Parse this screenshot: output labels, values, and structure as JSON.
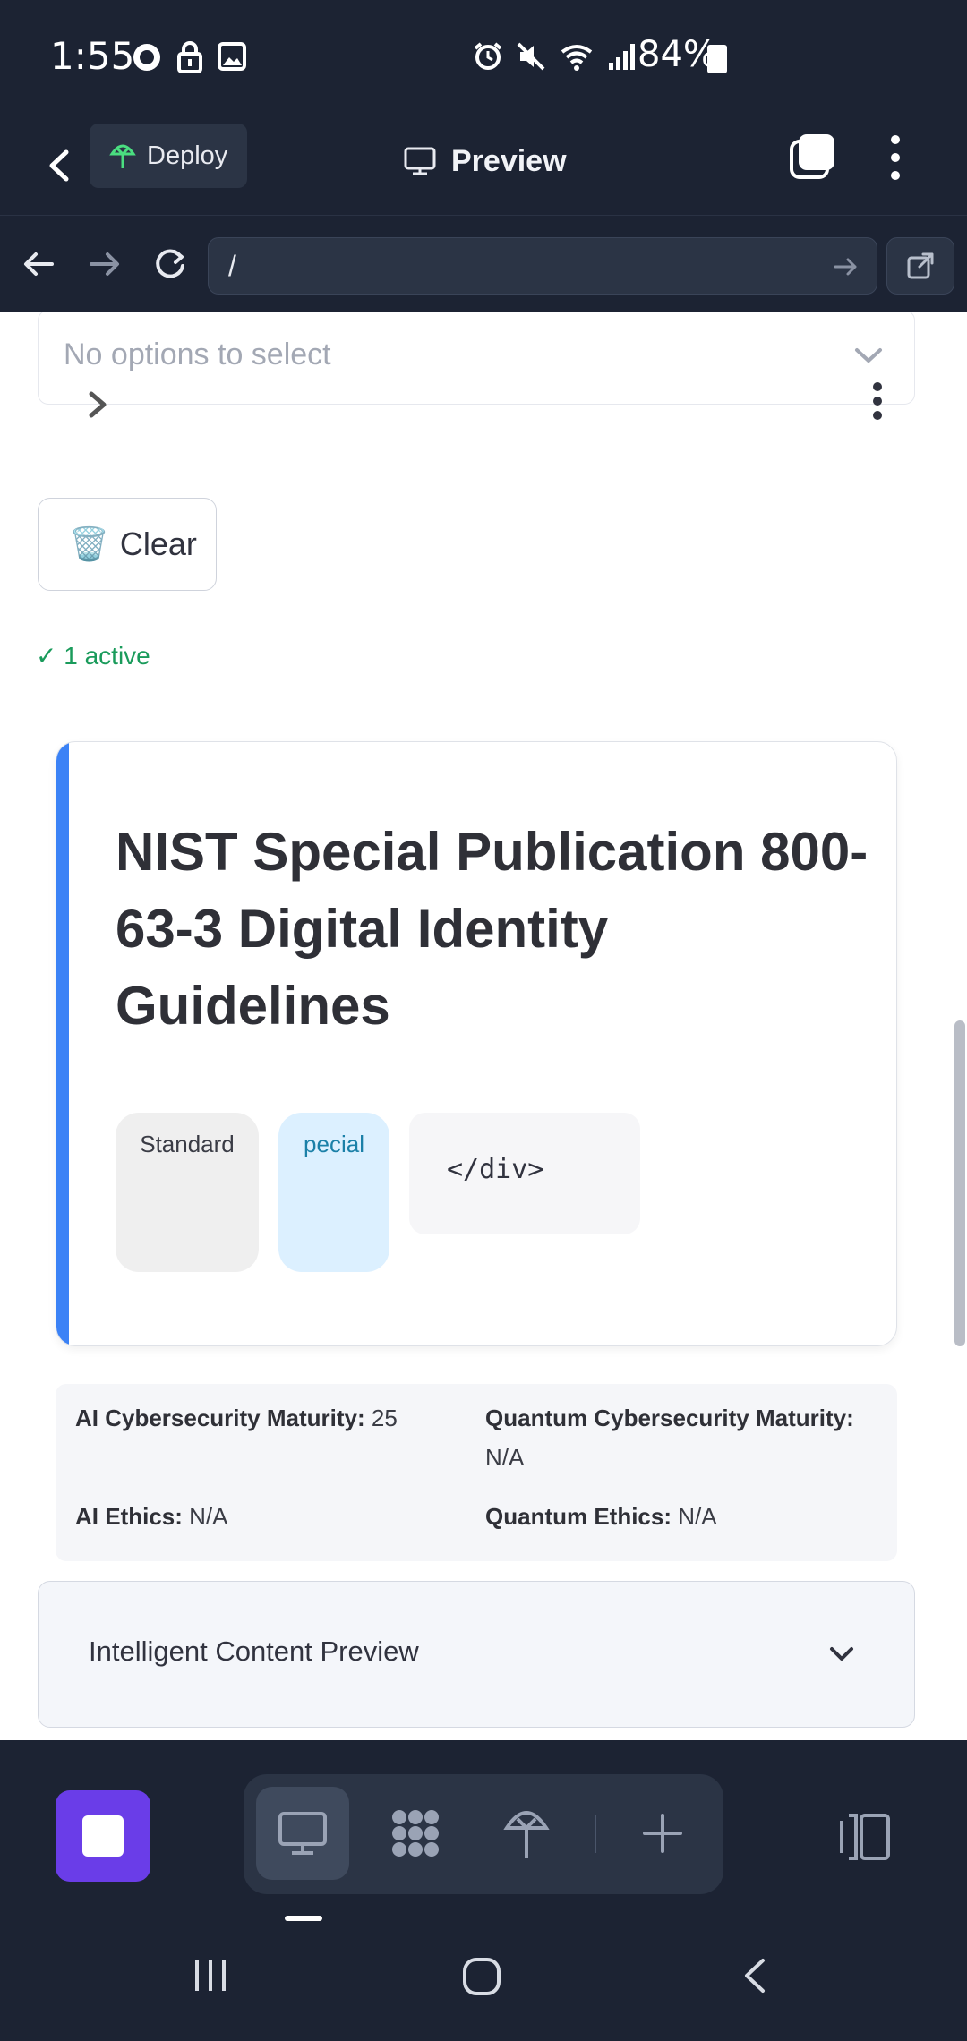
{
  "status_bar": {
    "time": "1:55",
    "battery": "84%",
    "left_icons": [
      "whatsapp-icon",
      "lock-icon",
      "gallery-icon"
    ],
    "right_icons": [
      "alarm-icon",
      "mute-icon",
      "wifi-icon",
      "signal-icon",
      "battery-icon"
    ]
  },
  "app_bar": {
    "deploy_label": "Deploy",
    "title": "Preview"
  },
  "browser": {
    "url": "/"
  },
  "multiselect": {
    "placeholder": "No options to select"
  },
  "clear_button": {
    "icon": "🗑️",
    "label": "Clear"
  },
  "active_status": "✓ 1 active",
  "document": {
    "title": "NIST Special Publication 800-63-3 Digital Identity Guidelines",
    "tags": [
      "Standard",
      "pecial"
    ],
    "code_snippet": "</div>",
    "accent_color": "#3b82f6"
  },
  "metrics": {
    "ai_cyber_label": "AI Cybersecurity Maturity:",
    "ai_cyber_value": "25",
    "quantum_cyber_label": "Quantum Cybersecurity Maturity:",
    "quantum_cyber_value": "N/A",
    "ai_ethics_label": "AI Ethics:",
    "ai_ethics_value": "N/A",
    "quantum_ethics_label": "Quantum Ethics:",
    "quantum_ethics_value": "N/A"
  },
  "expander": {
    "label": "Intelligent Content Preview"
  },
  "toolbar": {
    "accent_color": "#6a3de8",
    "tools": [
      "desktop-icon",
      "apps-icon",
      "deploy-icon",
      "add-icon"
    ]
  }
}
